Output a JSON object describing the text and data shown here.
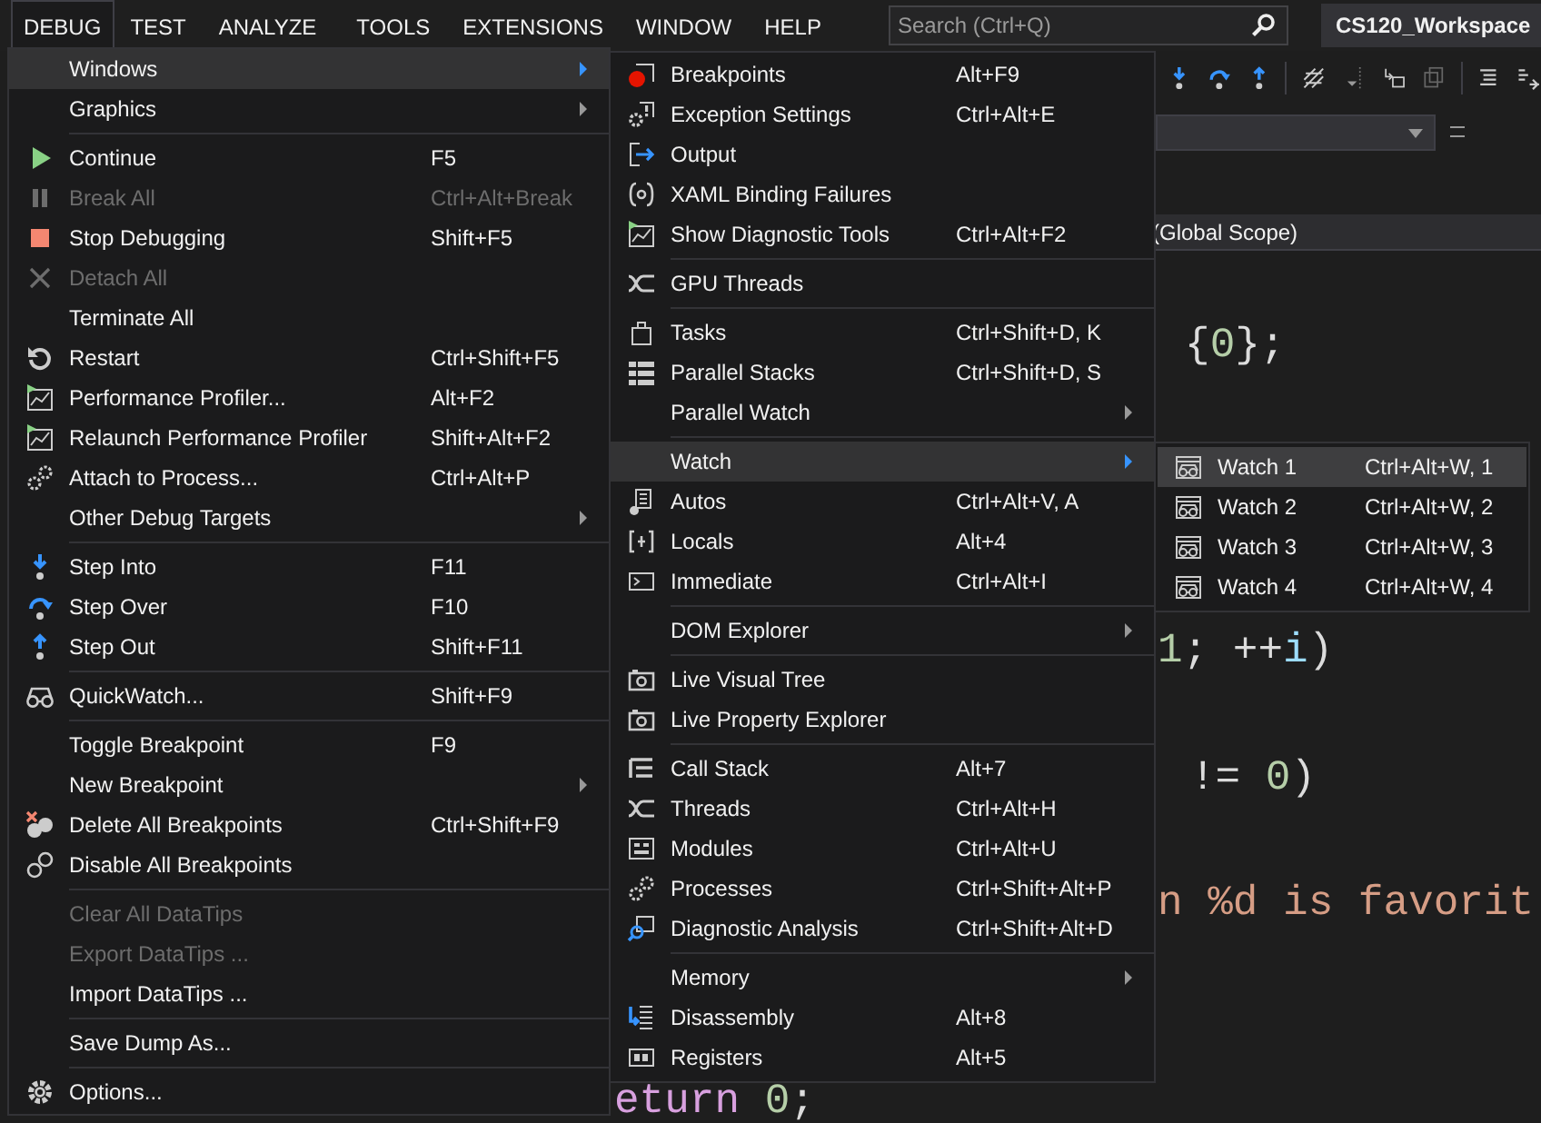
{
  "menubar": {
    "items": [
      {
        "label": "DEBUG",
        "selected": true
      },
      {
        "label": "TEST",
        "selected": false
      },
      {
        "label": "ANALYZE",
        "selected": false
      },
      {
        "label": "TOOLS",
        "selected": false
      },
      {
        "label": "EXTENSIONS",
        "selected": false
      },
      {
        "label": "WINDOW",
        "selected": false
      },
      {
        "label": "HELP",
        "selected": false
      }
    ]
  },
  "search": {
    "placeholder": "Search (Ctrl+Q)"
  },
  "workspace_title": "CS120_Workspace",
  "scope_bar": {
    "label": "(Global Scope)"
  },
  "code_lines": [
    [
      {
        "text": "{",
        "kind": "punct"
      },
      {
        "text": "0",
        "kind": "number"
      },
      {
        "text": "};",
        "kind": "punct"
      }
    ],
    [
      {
        "text": "1",
        "kind": "number"
      },
      {
        "text": "; ++",
        "kind": "punct"
      },
      {
        "text": "i",
        "kind": "ident"
      },
      {
        "text": ")",
        "kind": "punct"
      }
    ],
    [
      {
        "text": "!= ",
        "kind": "punct"
      },
      {
        "text": "0",
        "kind": "number"
      },
      {
        "text": ")",
        "kind": "punct"
      }
    ],
    [
      {
        "text": "n %d is favorit",
        "kind": "string"
      }
    ],
    [
      {
        "text": "eturn ",
        "kind": "keyword"
      },
      {
        "text": "0",
        "kind": "number"
      },
      {
        "text": ";",
        "kind": "punct"
      }
    ]
  ],
  "menus": [
    {
      "items": [
        {
          "kind": "item",
          "label": "Windows",
          "has_submenu": true,
          "disabled": false,
          "selected": true
        },
        {
          "kind": "item",
          "label": "Graphics",
          "has_submenu": true,
          "disabled": false,
          "selected": false
        },
        {
          "kind": "separator"
        },
        {
          "kind": "item",
          "label": "Continue",
          "shortcut": "F5",
          "has_submenu": false,
          "disabled": false,
          "selected": false
        },
        {
          "kind": "item",
          "label": "Break All",
          "shortcut": "Ctrl+Alt+Break",
          "has_submenu": false,
          "disabled": true,
          "selected": false
        },
        {
          "kind": "item",
          "label": "Stop Debugging",
          "shortcut": "Shift+F5",
          "has_submenu": false,
          "disabled": false,
          "selected": false
        },
        {
          "kind": "item",
          "label": "Detach All",
          "has_submenu": false,
          "disabled": true,
          "selected": false
        },
        {
          "kind": "item",
          "label": "Terminate All",
          "has_submenu": false,
          "disabled": false,
          "selected": false
        },
        {
          "kind": "item",
          "label": "Restart",
          "shortcut": "Ctrl+Shift+F5",
          "has_submenu": false,
          "disabled": false,
          "selected": false
        },
        {
          "kind": "item",
          "label": "Performance Profiler...",
          "shortcut": "Alt+F2",
          "has_submenu": false,
          "disabled": false,
          "selected": false
        },
        {
          "kind": "item",
          "label": "Relaunch Performance Profiler",
          "shortcut": "Shift+Alt+F2",
          "has_submenu": false,
          "disabled": false,
          "selected": false
        },
        {
          "kind": "item",
          "label": "Attach to Process...",
          "shortcut": "Ctrl+Alt+P",
          "has_submenu": false,
          "disabled": false,
          "selected": false
        },
        {
          "kind": "item",
          "label": "Other Debug Targets",
          "has_submenu": true,
          "disabled": false,
          "selected": false
        },
        {
          "kind": "separator"
        },
        {
          "kind": "item",
          "label": "Step Into",
          "shortcut": "F11",
          "has_submenu": false,
          "disabled": false,
          "selected": false
        },
        {
          "kind": "item",
          "label": "Step Over",
          "shortcut": "F10",
          "has_submenu": false,
          "disabled": false,
          "selected": false
        },
        {
          "kind": "item",
          "label": "Step Out",
          "shortcut": "Shift+F11",
          "has_submenu": false,
          "disabled": false,
          "selected": false
        },
        {
          "kind": "separator"
        },
        {
          "kind": "item",
          "label": "QuickWatch...",
          "shortcut": "Shift+F9",
          "has_submenu": false,
          "disabled": false,
          "selected": false
        },
        {
          "kind": "separator"
        },
        {
          "kind": "item",
          "label": "Toggle Breakpoint",
          "shortcut": "F9",
          "has_submenu": false,
          "disabled": false,
          "selected": false
        },
        {
          "kind": "item",
          "label": "New Breakpoint",
          "has_submenu": true,
          "disabled": false,
          "selected": false
        },
        {
          "kind": "item",
          "label": "Delete All Breakpoints",
          "shortcut": "Ctrl+Shift+F9",
          "has_submenu": false,
          "disabled": false,
          "selected": false
        },
        {
          "kind": "item",
          "label": "Disable All Breakpoints",
          "has_submenu": false,
          "disabled": false,
          "selected": false
        },
        {
          "kind": "separator"
        },
        {
          "kind": "item",
          "label": "Clear All DataTips",
          "has_submenu": false,
          "disabled": true,
          "selected": false
        },
        {
          "kind": "item",
          "label": "Export DataTips ...",
          "has_submenu": false,
          "disabled": true,
          "selected": false
        },
        {
          "kind": "item",
          "label": "Import DataTips ...",
          "has_submenu": false,
          "disabled": false,
          "selected": false
        },
        {
          "kind": "separator"
        },
        {
          "kind": "item",
          "label": "Save Dump As...",
          "has_submenu": false,
          "disabled": false,
          "selected": false
        },
        {
          "kind": "separator"
        },
        {
          "kind": "item",
          "label": "Options...",
          "has_submenu": false,
          "disabled": false,
          "selected": false
        }
      ]
    },
    {
      "items": [
        {
          "kind": "item",
          "label": "Breakpoints",
          "shortcut": "Alt+F9",
          "has_submenu": false,
          "selected": false
        },
        {
          "kind": "item",
          "label": "Exception Settings",
          "shortcut": "Ctrl+Alt+E",
          "has_submenu": false,
          "selected": false
        },
        {
          "kind": "item",
          "label": "Output",
          "has_submenu": false,
          "selected": false
        },
        {
          "kind": "item",
          "label": "XAML Binding Failures",
          "has_submenu": false,
          "selected": false
        },
        {
          "kind": "item",
          "label": "Show Diagnostic Tools",
          "shortcut": "Ctrl+Alt+F2",
          "has_submenu": false,
          "selected": false
        },
        {
          "kind": "separator"
        },
        {
          "kind": "item",
          "label": "GPU Threads",
          "has_submenu": false,
          "selected": false
        },
        {
          "kind": "separator"
        },
        {
          "kind": "item",
          "label": "Tasks",
          "shortcut": "Ctrl+Shift+D, K",
          "has_submenu": false,
          "selected": false
        },
        {
          "kind": "item",
          "label": "Parallel Stacks",
          "shortcut": "Ctrl+Shift+D, S",
          "has_submenu": false,
          "selected": false
        },
        {
          "kind": "item",
          "label": "Parallel Watch",
          "has_submenu": true,
          "selected": false
        },
        {
          "kind": "separator"
        },
        {
          "kind": "item",
          "label": "Watch",
          "has_submenu": true,
          "selected": true
        },
        {
          "kind": "item",
          "label": "Autos",
          "shortcut": "Ctrl+Alt+V, A",
          "has_submenu": false,
          "selected": false
        },
        {
          "kind": "item",
          "label": "Locals",
          "shortcut": "Alt+4",
          "has_submenu": false,
          "selected": false
        },
        {
          "kind": "item",
          "label": "Immediate",
          "shortcut": "Ctrl+Alt+I",
          "has_submenu": false,
          "selected": false
        },
        {
          "kind": "separator"
        },
        {
          "kind": "item",
          "label": "DOM Explorer",
          "has_submenu": true,
          "selected": false
        },
        {
          "kind": "separator"
        },
        {
          "kind": "item",
          "label": "Live Visual Tree",
          "has_submenu": false,
          "selected": false
        },
        {
          "kind": "item",
          "label": "Live Property Explorer",
          "has_submenu": false,
          "selected": false
        },
        {
          "kind": "separator"
        },
        {
          "kind": "item",
          "label": "Call Stack",
          "shortcut": "Alt+7",
          "has_submenu": false,
          "selected": false
        },
        {
          "kind": "item",
          "label": "Threads",
          "shortcut": "Ctrl+Alt+H",
          "has_submenu": false,
          "selected": false
        },
        {
          "kind": "item",
          "label": "Modules",
          "shortcut": "Ctrl+Alt+U",
          "has_submenu": false,
          "selected": false
        },
        {
          "kind": "item",
          "label": "Processes",
          "shortcut": "Ctrl+Shift+Alt+P",
          "has_submenu": false,
          "selected": false
        },
        {
          "kind": "item",
          "label": "Diagnostic Analysis",
          "shortcut": "Ctrl+Shift+Alt+D",
          "has_submenu": false,
          "selected": false
        },
        {
          "kind": "separator"
        },
        {
          "kind": "item",
          "label": "Memory",
          "has_submenu": true,
          "selected": false
        },
        {
          "kind": "item",
          "label": "Disassembly",
          "shortcut": "Alt+8",
          "has_submenu": false,
          "selected": false
        },
        {
          "kind": "item",
          "label": "Registers",
          "shortcut": "Alt+5",
          "has_submenu": false,
          "selected": false
        }
      ]
    },
    {
      "items": [
        {
          "kind": "item",
          "label": "Watch 1",
          "shortcut": "Ctrl+Alt+W, 1",
          "selected": true
        },
        {
          "kind": "item",
          "label": "Watch 2",
          "shortcut": "Ctrl+Alt+W, 2",
          "selected": false
        },
        {
          "kind": "item",
          "label": "Watch 3",
          "shortcut": "Ctrl+Alt+W, 3",
          "selected": false
        },
        {
          "kind": "item",
          "label": "Watch 4",
          "shortcut": "Ctrl+Alt+W, 4",
          "selected": false
        }
      ]
    }
  ]
}
